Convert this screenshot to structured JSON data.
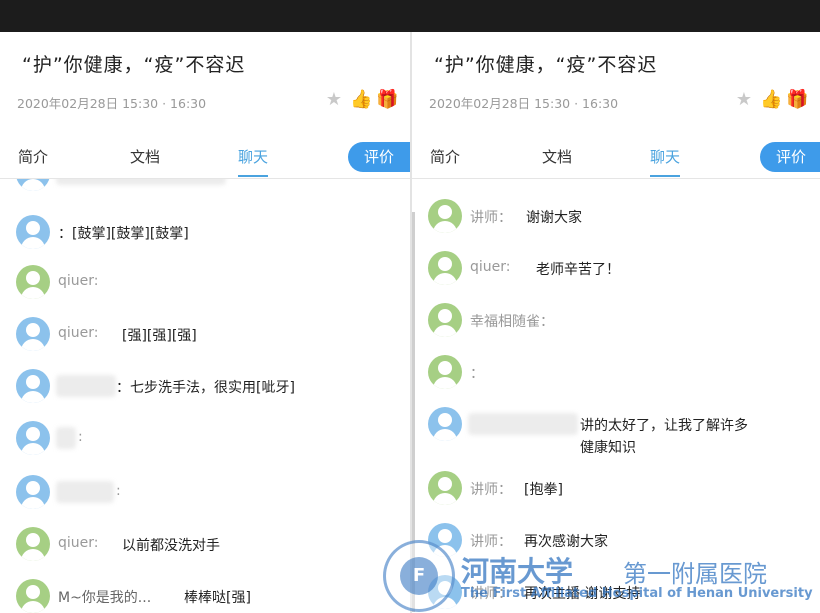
{
  "colors": {
    "accent": "#3e9bea",
    "avatar_blue": "#8cc2ec",
    "avatar_green": "#a6cf84",
    "muted": "#999999"
  },
  "panels": [
    {
      "title": "“护”你健康，“疫”不容迟",
      "time": "2020年02月28日 15:30 · 16:30",
      "actions": [
        "star-icon",
        "thumbs-up-icon",
        "gift-icon"
      ],
      "tabs": [
        "简介",
        "文档",
        "聊天"
      ],
      "active_tab": "聊天",
      "eval_button": "评价",
      "messages": [
        {
          "avatar": "blue",
          "sender": "",
          "text": "：[鼓掌][鼓掌][鼓掌]"
        },
        {
          "avatar": "green",
          "sender": "qiuer:",
          "text": ""
        },
        {
          "avatar": "blue",
          "sender": "qiuer:",
          "text": "[强][强][强]"
        },
        {
          "avatar": "blue",
          "sender": "",
          "text": "：七步洗手法，很实用[呲牙]"
        },
        {
          "avatar": "blue",
          "sender": ":",
          "text": ""
        },
        {
          "avatar": "blue",
          "sender": ":",
          "text": ""
        },
        {
          "avatar": "green",
          "sender": "qiuer:",
          "text": "以前都没洗对手"
        },
        {
          "avatar": "green",
          "sender": "M~你是我的...",
          "text": "棒棒哒[强]"
        }
      ]
    },
    {
      "title": "“护”你健康，“疫”不容迟",
      "time": "2020年02月28日 15:30 · 16:30",
      "actions": [
        "star-icon",
        "thumbs-up-icon",
        "gift-icon"
      ],
      "tabs": [
        "简介",
        "文档",
        "聊天"
      ],
      "active_tab": "聊天",
      "eval_button": "评价",
      "messages": [
        {
          "avatar": "green",
          "sender": "讲师：",
          "text": "谢谢大家"
        },
        {
          "avatar": "green",
          "sender": "qiuer:",
          "text": "老师辛苦了！"
        },
        {
          "avatar": "green",
          "sender": "幸福相随雀：",
          "text": ""
        },
        {
          "avatar": "green",
          "sender": "：",
          "text": ""
        },
        {
          "avatar": "blue",
          "sender": "",
          "text": "讲的太好了，让我了解许多",
          "text2": "健康知识"
        },
        {
          "avatar": "green",
          "sender": "讲师：",
          "text": "[抱拳]"
        },
        {
          "avatar": "blue",
          "sender": "讲师：",
          "text": "再次感谢大家"
        },
        {
          "avatar": "blue",
          "sender": "讲师：",
          "text": "再次主播 谢谢支持"
        }
      ]
    }
  ],
  "watermark": {
    "name": "河南大学",
    "name2": "第一附属医院",
    "english": "The First Affiliated Hospital of Henan University"
  }
}
